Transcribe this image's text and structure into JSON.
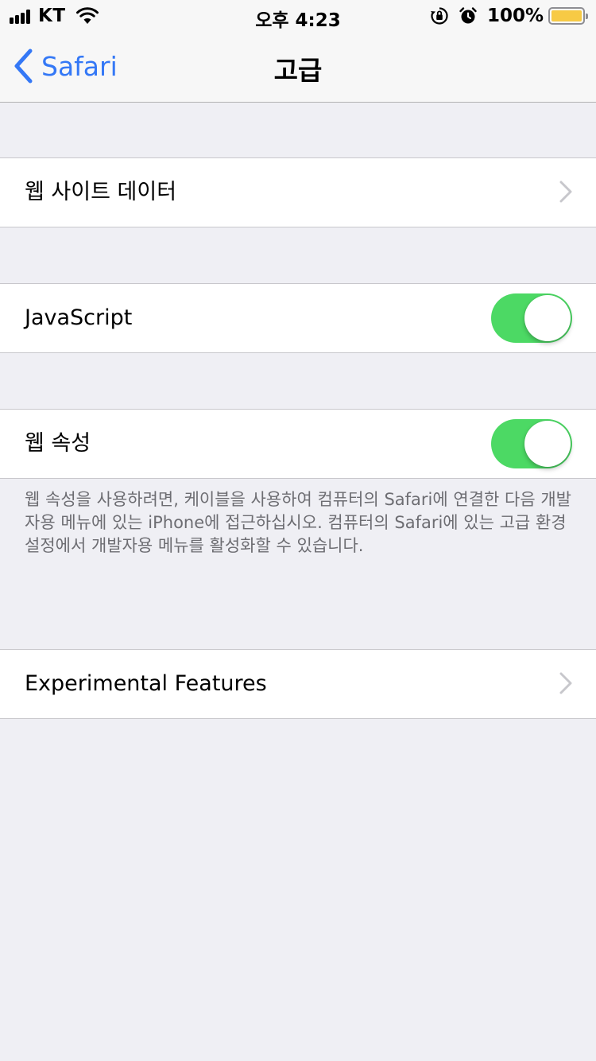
{
  "status_bar": {
    "carrier": "KT",
    "time": "오후 4:23",
    "battery_percent": "100%",
    "battery_level": 1.0,
    "battery_color": "#f7ca45",
    "icons": [
      "cellular-signal-icon",
      "wifi-icon",
      "orientation-lock-icon",
      "alarm-icon",
      "battery-icon"
    ]
  },
  "nav": {
    "back_label": "Safari",
    "title": "고급",
    "accent_color": "#3478f6"
  },
  "rows": {
    "website_data": {
      "label": "웹 사이트 데이터",
      "accessory": "chevron"
    },
    "javascript": {
      "label": "JavaScript",
      "toggle_on": true
    },
    "web_inspector": {
      "label": "웹 속성",
      "toggle_on": true
    },
    "experimental": {
      "label": "Experimental Features",
      "accessory": "chevron"
    }
  },
  "web_inspector_note": "웹 속성을 사용하려면, 케이블을 사용하여 컴퓨터의 Safari에 연결한 다음 개발자용 메뉴에 있는 iPhone에 접근하십시오. 컴퓨터의 Safari에 있는 고급 환경설정에서 개발자용 메뉴를 활성화할 수 있습니다.",
  "toggle_on_color": "#4cd964"
}
